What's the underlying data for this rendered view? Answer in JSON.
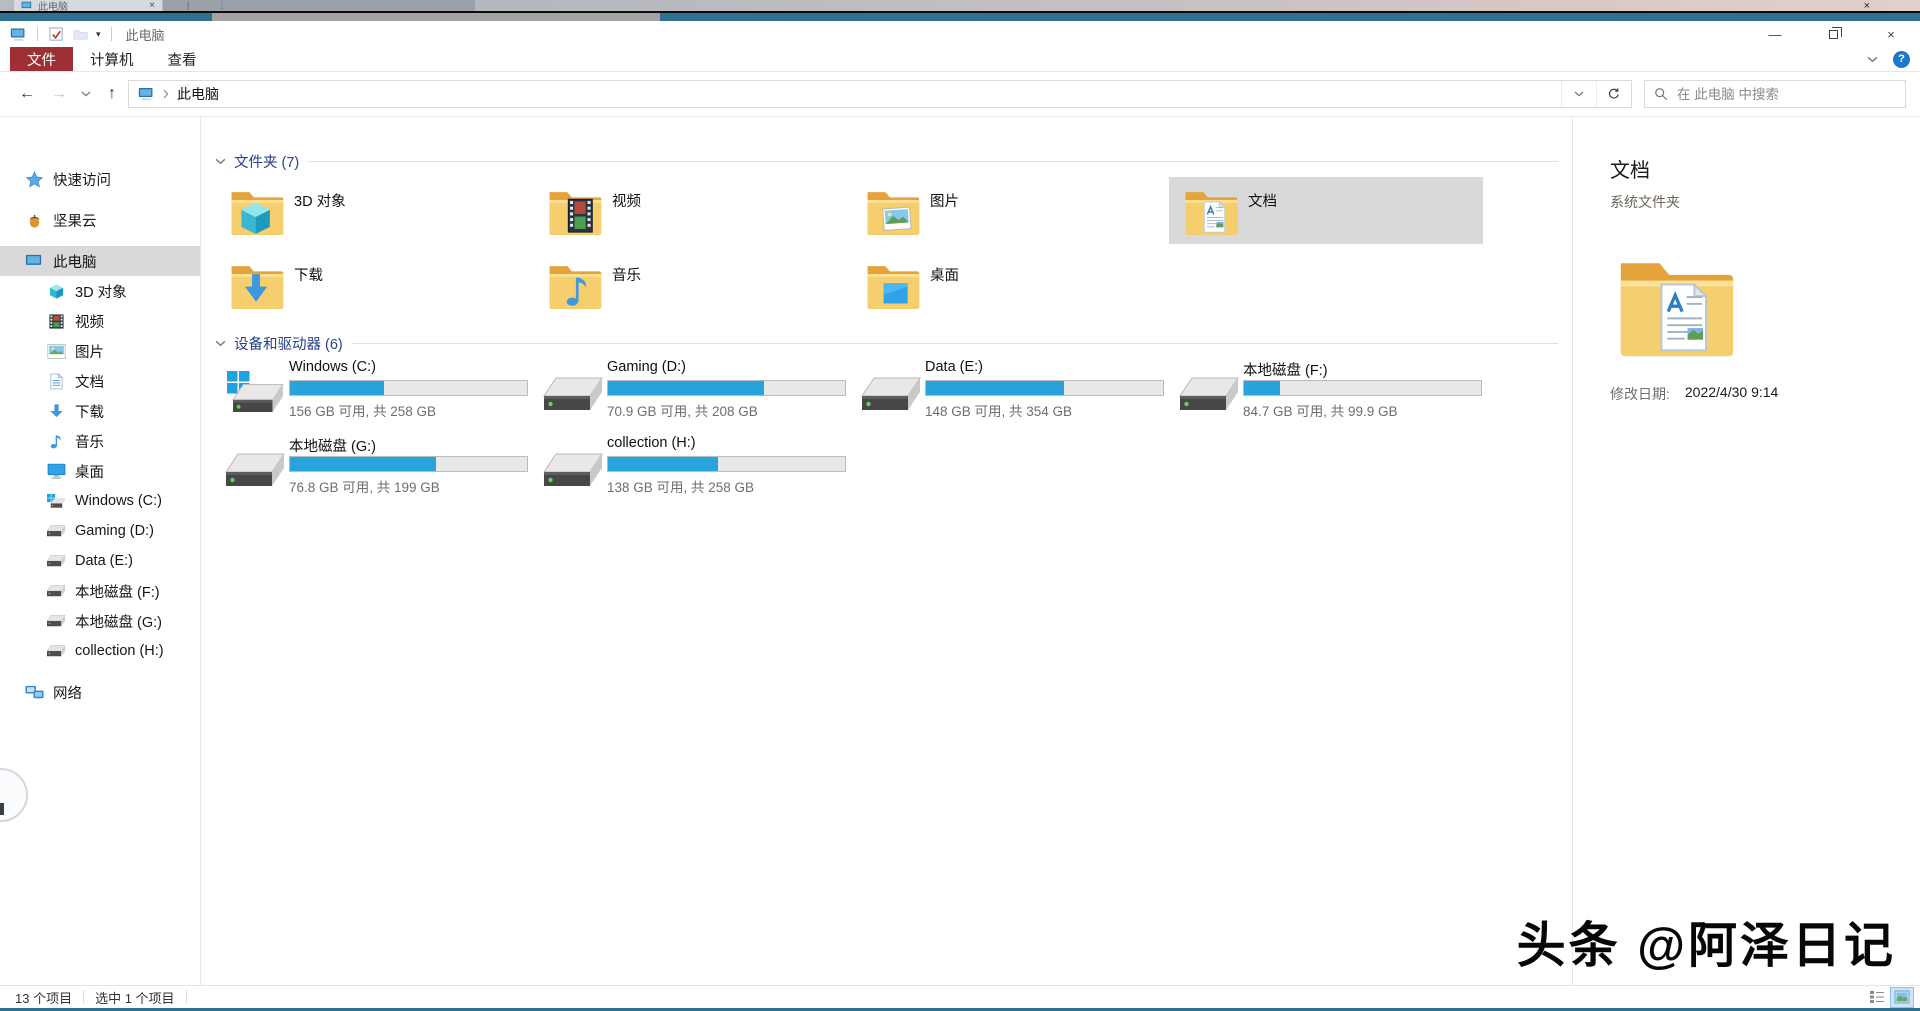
{
  "artifact_strip": {
    "tab_title": "此电脑",
    "tab_icon": "computer-icon",
    "close_glyph": "×",
    "pipe_glyph": "|",
    "dots_glyph": "⋮"
  },
  "titlebar": {
    "title": "此电脑",
    "quick_access": {
      "pc_icon": "computer-icon",
      "check_icon": "check-icon",
      "new_folder_icon": "folder-plain-icon",
      "dropdown_glyph": "▾"
    },
    "controls": {
      "minimize_glyph": "—",
      "restore_icon": "restore-icon",
      "close_glyph": "×"
    }
  },
  "ribbon": {
    "tabs": [
      {
        "label": "文件",
        "style": "file"
      },
      {
        "label": "计算机",
        "style": "normal"
      },
      {
        "label": "查看",
        "style": "normal"
      }
    ],
    "collapse_icon": "chevron-down-icon",
    "help_glyph": "?"
  },
  "address_bar": {
    "back_glyph": "←",
    "forward_glyph": "→",
    "recent_icon": "chevron-down-icon",
    "up_glyph": "↑",
    "crumb_icon": "computer-icon",
    "separator_icon": "chevron-right-icon",
    "path": "此电脑",
    "history_icon": "chevron-down-icon",
    "refresh_icon": "refresh-icon",
    "search_icon": "magnifier-icon",
    "search_placeholder": "在 此电脑 中搜索"
  },
  "sidebar": {
    "items": [
      {
        "label": "快速访问",
        "icon": "star-icon",
        "level": 0,
        "selected": false,
        "group_start": true
      },
      {
        "label": "坚果云",
        "icon": "acorn-icon",
        "level": 0,
        "selected": false,
        "group_start": true
      },
      {
        "label": "此电脑",
        "icon": "computer-icon",
        "level": 0,
        "selected": true,
        "group_start": true
      },
      {
        "label": "3D 对象",
        "icon": "cube-icon",
        "level": 1,
        "selected": false
      },
      {
        "label": "视频",
        "icon": "film-icon",
        "level": 1,
        "selected": false
      },
      {
        "label": "图片",
        "icon": "picture-icon",
        "level": 1,
        "selected": false
      },
      {
        "label": "文档",
        "icon": "document-icon",
        "level": 1,
        "selected": false
      },
      {
        "label": "下载",
        "icon": "download-icon",
        "level": 1,
        "selected": false
      },
      {
        "label": "音乐",
        "icon": "music-icon",
        "level": 1,
        "selected": false
      },
      {
        "label": "桌面",
        "icon": "desktop-icon",
        "level": 1,
        "selected": false
      },
      {
        "label": "Windows (C:)",
        "icon": "drive-windows-icon",
        "level": 1,
        "selected": false
      },
      {
        "label": "Gaming (D:)",
        "icon": "drive-icon",
        "level": 1,
        "selected": false
      },
      {
        "label": "Data (E:)",
        "icon": "drive-icon",
        "level": 1,
        "selected": false
      },
      {
        "label": "本地磁盘 (F:)",
        "icon": "drive-icon",
        "level": 1,
        "selected": false
      },
      {
        "label": "本地磁盘 (G:)",
        "icon": "drive-icon",
        "level": 1,
        "selected": false
      },
      {
        "label": "collection (H:)",
        "icon": "drive-icon",
        "level": 1,
        "selected": false
      },
      {
        "label": "网络",
        "icon": "network-icon",
        "level": 0,
        "selected": false,
        "group_start": true
      }
    ]
  },
  "folders_section": {
    "header": "文件夹 (7)",
    "collapse_icon": "chevron-down-icon",
    "tiles": [
      {
        "label": "3D 对象",
        "icon": "folder-3d-icon",
        "selected": false
      },
      {
        "label": "视频",
        "icon": "folder-video-icon",
        "selected": false
      },
      {
        "label": "图片",
        "icon": "folder-picture-icon",
        "selected": false
      },
      {
        "label": "文档",
        "icon": "folder-doc-icon",
        "selected": true
      },
      {
        "label": "下载",
        "icon": "folder-download-icon",
        "selected": false
      },
      {
        "label": "音乐",
        "icon": "folder-music-icon",
        "selected": false
      },
      {
        "label": "桌面",
        "icon": "folder-desktop-icon",
        "selected": false
      }
    ]
  },
  "drives_section": {
    "header": "设备和驱动器 (6)",
    "collapse_icon": "chevron-down-icon",
    "tiles": [
      {
        "name": "Windows (C:)",
        "capacity": "156 GB 可用, 共 258 GB",
        "pct_used": 39.5,
        "icon": "drive-windows-big-icon"
      },
      {
        "name": "Gaming (D:)",
        "capacity": "70.9 GB 可用, 共 208 GB",
        "pct_used": 65.9,
        "icon": "drive-big-icon"
      },
      {
        "name": "Data (E:)",
        "capacity": "148 GB 可用, 共 354 GB",
        "pct_used": 58.2,
        "icon": "drive-big-icon"
      },
      {
        "name": "本地磁盘 (F:)",
        "capacity": "84.7 GB 可用, 共 99.9 GB",
        "pct_used": 15.2,
        "icon": "drive-big-icon"
      },
      {
        "name": "本地磁盘 (G:)",
        "capacity": "76.8 GB 可用, 共 199 GB",
        "pct_used": 61.4,
        "icon": "drive-big-icon"
      },
      {
        "name": "collection (H:)",
        "capacity": "138 GB 可用, 共 258 GB",
        "pct_used": 46.5,
        "icon": "drive-big-icon"
      }
    ]
  },
  "details_panel": {
    "title": "文档",
    "subtitle": "系统文件夹",
    "icon": "folder-doc-large-icon",
    "modified_label": "修改日期:",
    "modified_value": "2022/4/30 9:14"
  },
  "status_bar": {
    "items_count": "13 个项目",
    "selected_count": "选中 1 个项目",
    "view_details_icon": "view-details-icon",
    "view_thumbs_icon": "view-thumbnails-icon"
  },
  "watermark": "头条 @阿泽日记",
  "colors": {
    "accent_teal": "#2f7092",
    "file_tab_red": "#9c3034",
    "progress_fill": "#29a3dc",
    "selection_gray": "#d9d9d9",
    "group_header_blue": "#26428b"
  }
}
